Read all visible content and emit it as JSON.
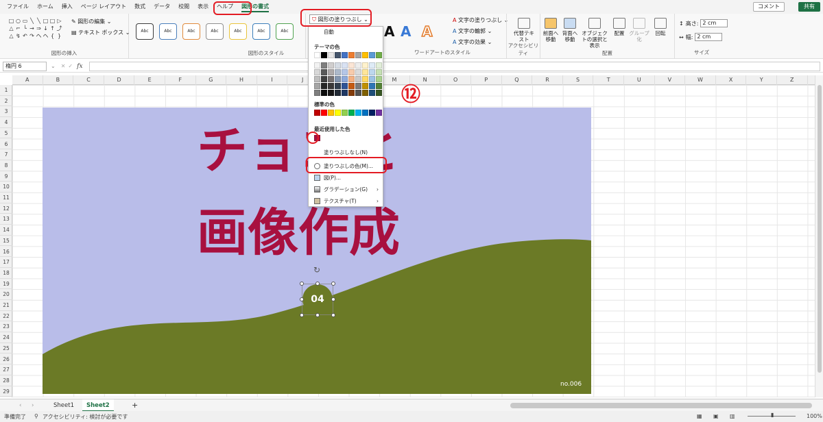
{
  "menu": {
    "tabs": [
      "ファイル",
      "ホーム",
      "挿入",
      "ページ レイアウト",
      "数式",
      "データ",
      "校閲",
      "表示",
      "ヘルプ",
      "図形の書式"
    ],
    "active_tab": "図形の書式",
    "comment": "コメント",
    "share": "共有"
  },
  "ribbon": {
    "insert_shapes": {
      "label": "図形の挿入",
      "edit_shape": "図形の編集",
      "text_box": "テキスト ボックス",
      "glyphs": [
        "□",
        "○",
        "▭",
        "╲",
        "╲",
        "□",
        "□",
        "▷",
        "△",
        "⌐",
        "└",
        "→",
        "⇒",
        "↓",
        "↑",
        "⤴",
        "△",
        "↯",
        "↶",
        "↷",
        "ヘ",
        "ヘ",
        "{",
        "}"
      ]
    },
    "shape_styles": {
      "label": "図形のスタイル",
      "preset": "Abc",
      "fill_button": "図形の塗りつぶし",
      "colors": [
        "#3b3b3b",
        "#4a7ebb",
        "#e08a3b",
        "#8f8f8f",
        "#e9c43b",
        "#3b7ebb",
        "#4fa24f"
      ]
    },
    "wordart": {
      "label": "ワードアートのスタイル",
      "text_fill": "文字の塗りつぶし",
      "text_outline": "文字の輪郭",
      "text_effects": "文字の効果"
    },
    "accessibility": {
      "label": "アクセシビリティ",
      "alt_text": "代替テキスト"
    },
    "arrange": {
      "label": "配置",
      "bring_forward": "前面へ移動",
      "send_backward": "背面へ移動",
      "selection_pane": "オブジェクトの選択と表示",
      "align": "配置",
      "group": "グループ化",
      "rotate": "回転"
    },
    "size": {
      "label": "サイズ",
      "height_label": "高さ:",
      "height_value": "2 cm",
      "width_label": "幅:",
      "width_value": "2 cm"
    }
  },
  "formula_bar": {
    "name_box": "楕円 6",
    "fx": "fx"
  },
  "grid": {
    "columns": [
      "A",
      "B",
      "C",
      "D",
      "E",
      "F",
      "G",
      "H",
      "I",
      "J",
      "K",
      "L",
      "M",
      "N",
      "O",
      "P",
      "Q",
      "R",
      "S",
      "T",
      "U",
      "V",
      "W",
      "X",
      "Y",
      "Z"
    ],
    "rows": [
      "1",
      "2",
      "3",
      "4",
      "5",
      "6",
      "7",
      "8",
      "9",
      "10",
      "11",
      "12",
      "13",
      "14",
      "15",
      "16",
      "17",
      "18",
      "19",
      "20",
      "21",
      "22",
      "23",
      "24",
      "25",
      "26",
      "27",
      "28",
      "29"
    ]
  },
  "image": {
    "title_line1": "チョコと",
    "title_line2": "画像作成",
    "footer_text": "no.006",
    "colors": {
      "sky": "#b9bde9",
      "hill": "#6b7a26",
      "title": "#a8103f"
    }
  },
  "selected_shape": {
    "label": "04",
    "fill": "#6b7a26"
  },
  "step_marker": "⑫",
  "fill_dropdown": {
    "auto_item": "自動",
    "theme_colors_heading": "テーマの色",
    "theme_top_row": [
      "#ffffff",
      "#000000",
      "#e7e6e6",
      "#44546a",
      "#4472c4",
      "#ed7d31",
      "#a5a5a5",
      "#ffc000",
      "#5b9bd5",
      "#70ad47"
    ],
    "theme_shades": [
      [
        "#f2f2f2",
        "#7f7f7f",
        "#d0cece",
        "#d6dce4",
        "#d9e2f3",
        "#fbe5d5",
        "#ededed",
        "#fff2cc",
        "#deebf6",
        "#e2efd9"
      ],
      [
        "#d8d8d8",
        "#595959",
        "#aeaaaa",
        "#adb9ca",
        "#b4c6e7",
        "#f7cbac",
        "#dbdbdb",
        "#fee599",
        "#bdd7ee",
        "#c5e0b3"
      ],
      [
        "#bfbfbf",
        "#3f3f3f",
        "#757070",
        "#8496b0",
        "#8eaadb",
        "#f4b183",
        "#c9c9c9",
        "#ffd965",
        "#9cc3e5",
        "#a8d08d"
      ],
      [
        "#a5a5a5",
        "#262626",
        "#3a3838",
        "#323f4f",
        "#2f5496",
        "#c55a11",
        "#7b7b7b",
        "#bf9000",
        "#2e75b5",
        "#538135"
      ],
      [
        "#7f7f7f",
        "#0c0c0c",
        "#171616",
        "#222a35",
        "#1f3864",
        "#833c0b",
        "#525252",
        "#7f6000",
        "#1e4e79",
        "#375623"
      ]
    ],
    "standard_colors_heading": "標準の色",
    "standard_colors": [
      "#c00000",
      "#ff0000",
      "#ffc000",
      "#ffff00",
      "#92d050",
      "#00b050",
      "#00b0f0",
      "#0070c0",
      "#002060",
      "#7030a0"
    ],
    "recent_colors_heading": "最近使用した色",
    "recent_colors": [
      "#a8103f"
    ],
    "no_fill": "塗りつぶしなし(N)",
    "more_colors": "塗りつぶしの色(M)...",
    "picture": "図(P)...",
    "gradient": "グラデーション(G)",
    "texture": "テクスチャ(T)"
  },
  "sheets": {
    "tabs": [
      "Sheet1",
      "Sheet2"
    ],
    "active": "Sheet2",
    "add": "+"
  },
  "status": {
    "ready": "準備完了",
    "accessibility": "アクセシビリティ: 検討が必要です",
    "zoom": "100%"
  }
}
